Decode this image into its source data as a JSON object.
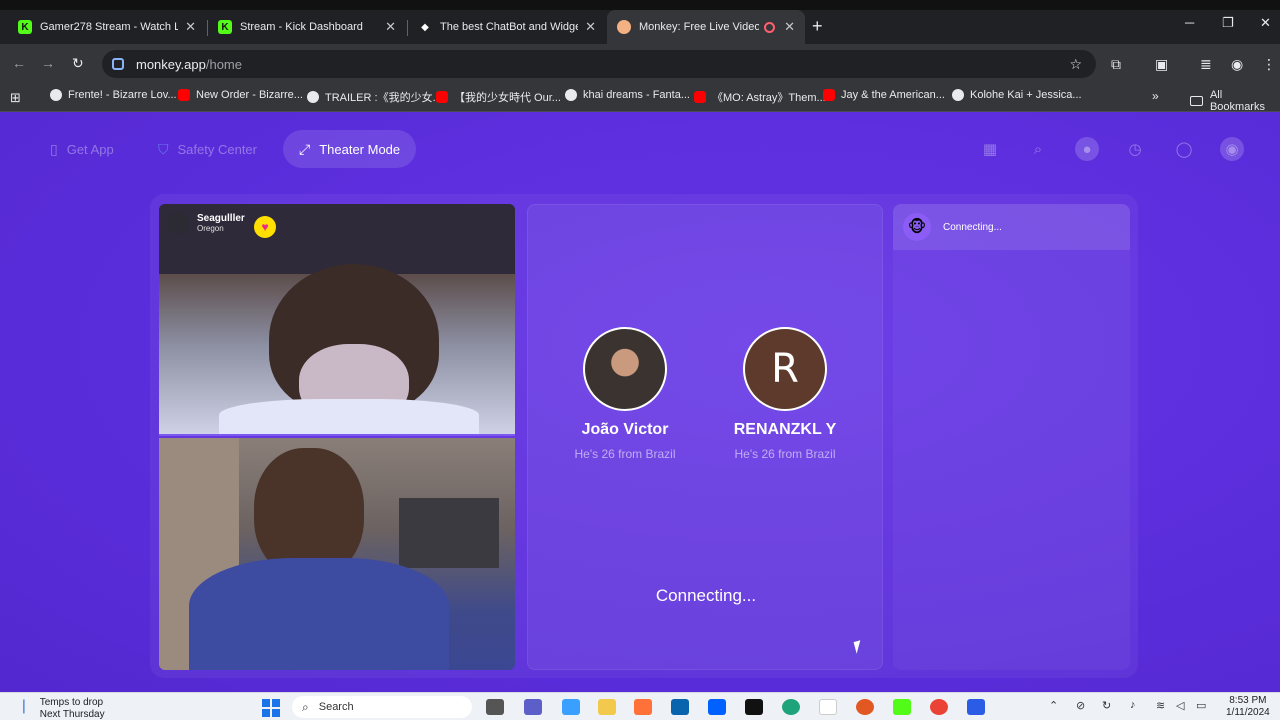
{
  "browser": {
    "tabs": [
      {
        "title": "Gamer278 Stream - Watch Live",
        "favicon": "kick-icon",
        "color": "#53fc18"
      },
      {
        "title": "Stream - Kick Dashboard",
        "favicon": "kick-icon",
        "color": "#53fc18"
      },
      {
        "title": "The best ChatBot and Widgets f",
        "favicon": "diamond-icon",
        "color": "#ffffff"
      },
      {
        "title": "Monkey: Free Live Video Ch",
        "favicon": "monkey-icon",
        "color": "#f4b183"
      }
    ],
    "new_tab": "+",
    "url_host": "monkey.app",
    "url_path": "/home",
    "bookmarks": [
      {
        "label": "Frente! - Bizarre Lov...",
        "icon": "globe-icon"
      },
      {
        "label": "New Order - Bizarre...",
        "icon": "youtube-icon"
      },
      {
        "label": "TRAILER :《我的少女...",
        "icon": "globe-icon"
      },
      {
        "label": "【我的少女時代 Our...",
        "icon": "youtube-icon"
      },
      {
        "label": "khai dreams - Fanta...",
        "icon": "globe-icon"
      },
      {
        "label": "《MO: Astray》Them...",
        "icon": "youtube-icon"
      },
      {
        "label": "Jay & the American...",
        "icon": "youtube-icon"
      },
      {
        "label": "Kolohe Kai + Jessica...",
        "icon": "globe-icon"
      }
    ],
    "more_bookmarks": "»",
    "all_bookmarks": "All Bookmarks"
  },
  "nav": {
    "get_app": "Get App",
    "safety_center": "Safety Center",
    "theater_mode": "Theater Mode"
  },
  "video": {
    "username": "Seagulller",
    "location": "Oregon"
  },
  "match": {
    "profiles": [
      {
        "name": "João Victor",
        "meta": "He's 26 from Brazil",
        "avatar": "photo"
      },
      {
        "name": "RENANZKL Y",
        "meta": "He's 26 from Brazil",
        "avatar": "R"
      }
    ],
    "status": "Connecting..."
  },
  "side": {
    "status": "Connecting..."
  },
  "taskbar": {
    "weather_line1": "Temps to drop",
    "weather_line2": "Next Thursday",
    "search_placeholder": "Search",
    "time": "8:53 PM",
    "date": "1/11/2024"
  },
  "colors": {
    "page_bg": "#5b2fd9",
    "accent_yellow": "#ffe000"
  }
}
